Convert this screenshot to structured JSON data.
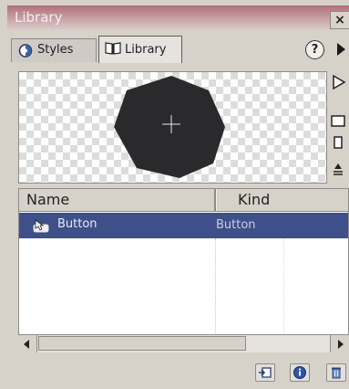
{
  "window": {
    "title": "Library",
    "close_glyph": "×"
  },
  "tabs": [
    {
      "label": "Styles",
      "icon": "styles-icon",
      "active": false
    },
    {
      "label": "Library",
      "icon": "library-book-icon",
      "active": true
    }
  ],
  "toolbar": {
    "help_glyph": "?",
    "menu_icon": "panel-menu-arrow-icon"
  },
  "preview": {
    "symbol_shape": "heptagon",
    "fill_color": "#2a2a2c",
    "crosshair": "+"
  },
  "side_tools": [
    "play-preview-icon",
    "wide-view-icon",
    "narrow-view-icon",
    "sort-order-icon"
  ],
  "list": {
    "columns": [
      "Name",
      "Kind"
    ],
    "rows": [
      {
        "name": "Button",
        "kind": "Button",
        "icon": "button-symbol-icon",
        "selected": true
      }
    ]
  },
  "bottom_buttons": [
    {
      "icon": "new-symbol-icon"
    },
    {
      "icon": "properties-icon"
    },
    {
      "icon": "trash-icon"
    }
  ],
  "colors": {
    "selection": "#3e4f8a",
    "titlebar": "#b0707a"
  }
}
